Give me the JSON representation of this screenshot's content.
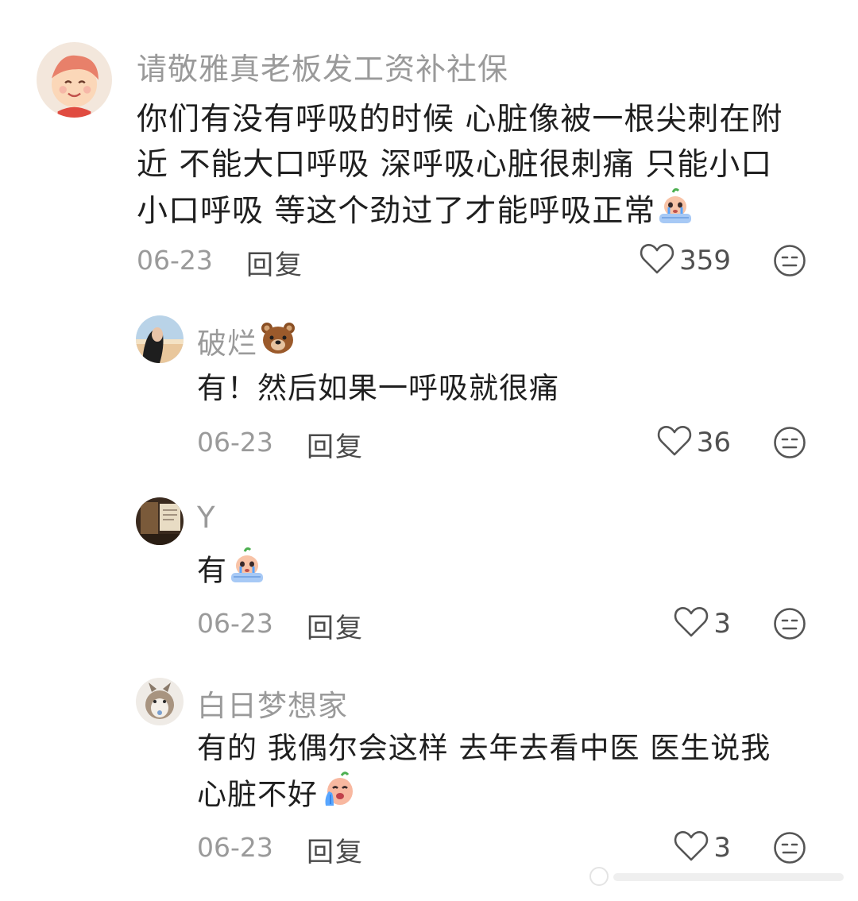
{
  "comments": [
    {
      "username": "请敬雅真老板发工资补社保",
      "lines": [
        "你们有没有呼吸的时候 心脏像被一根尖刺在附",
        "近 不能大口呼吸 深呼吸心脏很刺痛 只能小口",
        "小口呼吸 等这个劲过了才能呼吸正常"
      ],
      "emoji": "crying-face-emoji",
      "date": "06-23",
      "reply_label": "回复",
      "likes": "359"
    },
    {
      "username": "破烂",
      "username_emoji": "bear-emoji",
      "lines": [
        "有！然后如果一呼吸就很痛"
      ],
      "date": "06-23",
      "reply_label": "回复",
      "likes": "36"
    },
    {
      "username": "Y",
      "lines": [
        "有"
      ],
      "emoji": "crying-face-emoji",
      "date": "06-23",
      "reply_label": "回复",
      "likes": "3"
    },
    {
      "username": "白日梦想家",
      "lines": [
        "有的 我偶尔会这样 去年去看中医 医生说我",
        "心脏不好"
      ],
      "emoji": "sobbing-face-emoji",
      "date": "06-23",
      "reply_label": "回复",
      "likes": "3"
    }
  ],
  "icons": {
    "like": "heart-outline-icon",
    "dislike": "neutral-face-icon"
  },
  "colors": {
    "username": "#9a9a9a",
    "body_text": "#1f1f1f",
    "meta_text": "#9a9a9a",
    "icon": "#555555"
  }
}
